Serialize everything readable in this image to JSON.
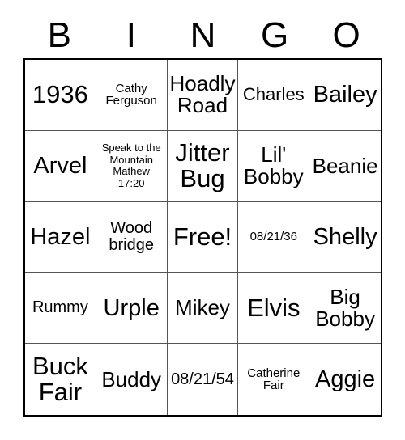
{
  "card": {
    "title": "BINGO Card",
    "header_letters": [
      "B",
      "I",
      "N",
      "G",
      "O"
    ],
    "free_space_label": "Free!",
    "rows": [
      [
        {
          "text": "1936",
          "size": "fs-xl"
        },
        {
          "text": "Cathy\nFerguson",
          "size": "fs-xxs"
        },
        {
          "text": "Hoadly\nRoad",
          "size": "fs-md"
        },
        {
          "text": "Charles",
          "size": "fs-sm"
        },
        {
          "text": "Bailey",
          "size": "fs-lg"
        }
      ],
      [
        {
          "text": "Arvel",
          "size": "fs-lg"
        },
        {
          "text": "Speak to the\nMountain\nMathew\n17:20",
          "size": "fs-tiny"
        },
        {
          "text": "Jitter\nBug",
          "size": "fs-xl"
        },
        {
          "text": "Lil'\nBobby",
          "size": "fs-md"
        },
        {
          "text": "Beanie",
          "size": "fs-md"
        }
      ],
      [
        {
          "text": "Hazel",
          "size": "fs-lg"
        },
        {
          "text": "Wood\nbridge",
          "size": "fs-xs"
        },
        {
          "text": "Free!",
          "size": "fs-xl"
        },
        {
          "text": "08/21/36",
          "size": "fs-xxs"
        },
        {
          "text": "Shelly",
          "size": "fs-lg"
        }
      ],
      [
        {
          "text": "Rummy",
          "size": "fs-xs"
        },
        {
          "text": "Urple",
          "size": "fs-lg"
        },
        {
          "text": "Mikey",
          "size": "fs-md"
        },
        {
          "text": "Elvis",
          "size": "fs-xl"
        },
        {
          "text": "Big\nBobby",
          "size": "fs-md"
        }
      ],
      [
        {
          "text": "Buck\nFair",
          "size": "fs-xl"
        },
        {
          "text": "Buddy",
          "size": "fs-md"
        },
        {
          "text": "08/21/54",
          "size": "fs-xs"
        },
        {
          "text": "Catherine\nFair",
          "size": "fs-xxs"
        },
        {
          "text": "Aggie",
          "size": "fs-lg"
        }
      ]
    ]
  },
  "colors": {
    "background": "#ffffff",
    "text": "#000000",
    "outer_border": "#000000",
    "inner_border": "#555555"
  }
}
